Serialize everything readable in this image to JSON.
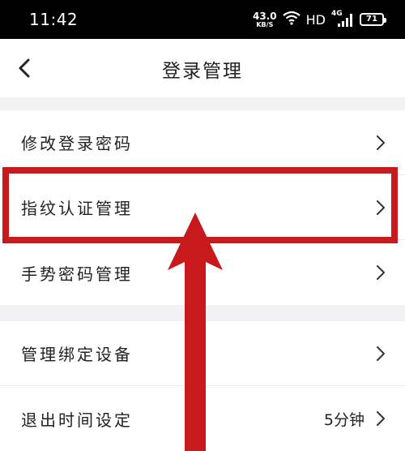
{
  "status_bar": {
    "time": "11:42",
    "net_speed_value": "43.0",
    "net_speed_unit": "KB/S",
    "hd": "HD",
    "signal_label": "4G",
    "battery": "71"
  },
  "nav": {
    "title": "登录管理"
  },
  "groups": [
    {
      "items": [
        {
          "label": "修改登录密码"
        },
        {
          "label": "指纹认证管理"
        },
        {
          "label": "手势密码管理"
        }
      ]
    },
    {
      "items": [
        {
          "label": "管理绑定设备"
        },
        {
          "label": "退出时间设定",
          "value": "5分钟"
        }
      ]
    }
  ],
  "colors": {
    "highlight": "#c8191c",
    "separator": "#f2f2f4",
    "status_bar": "#000000"
  }
}
